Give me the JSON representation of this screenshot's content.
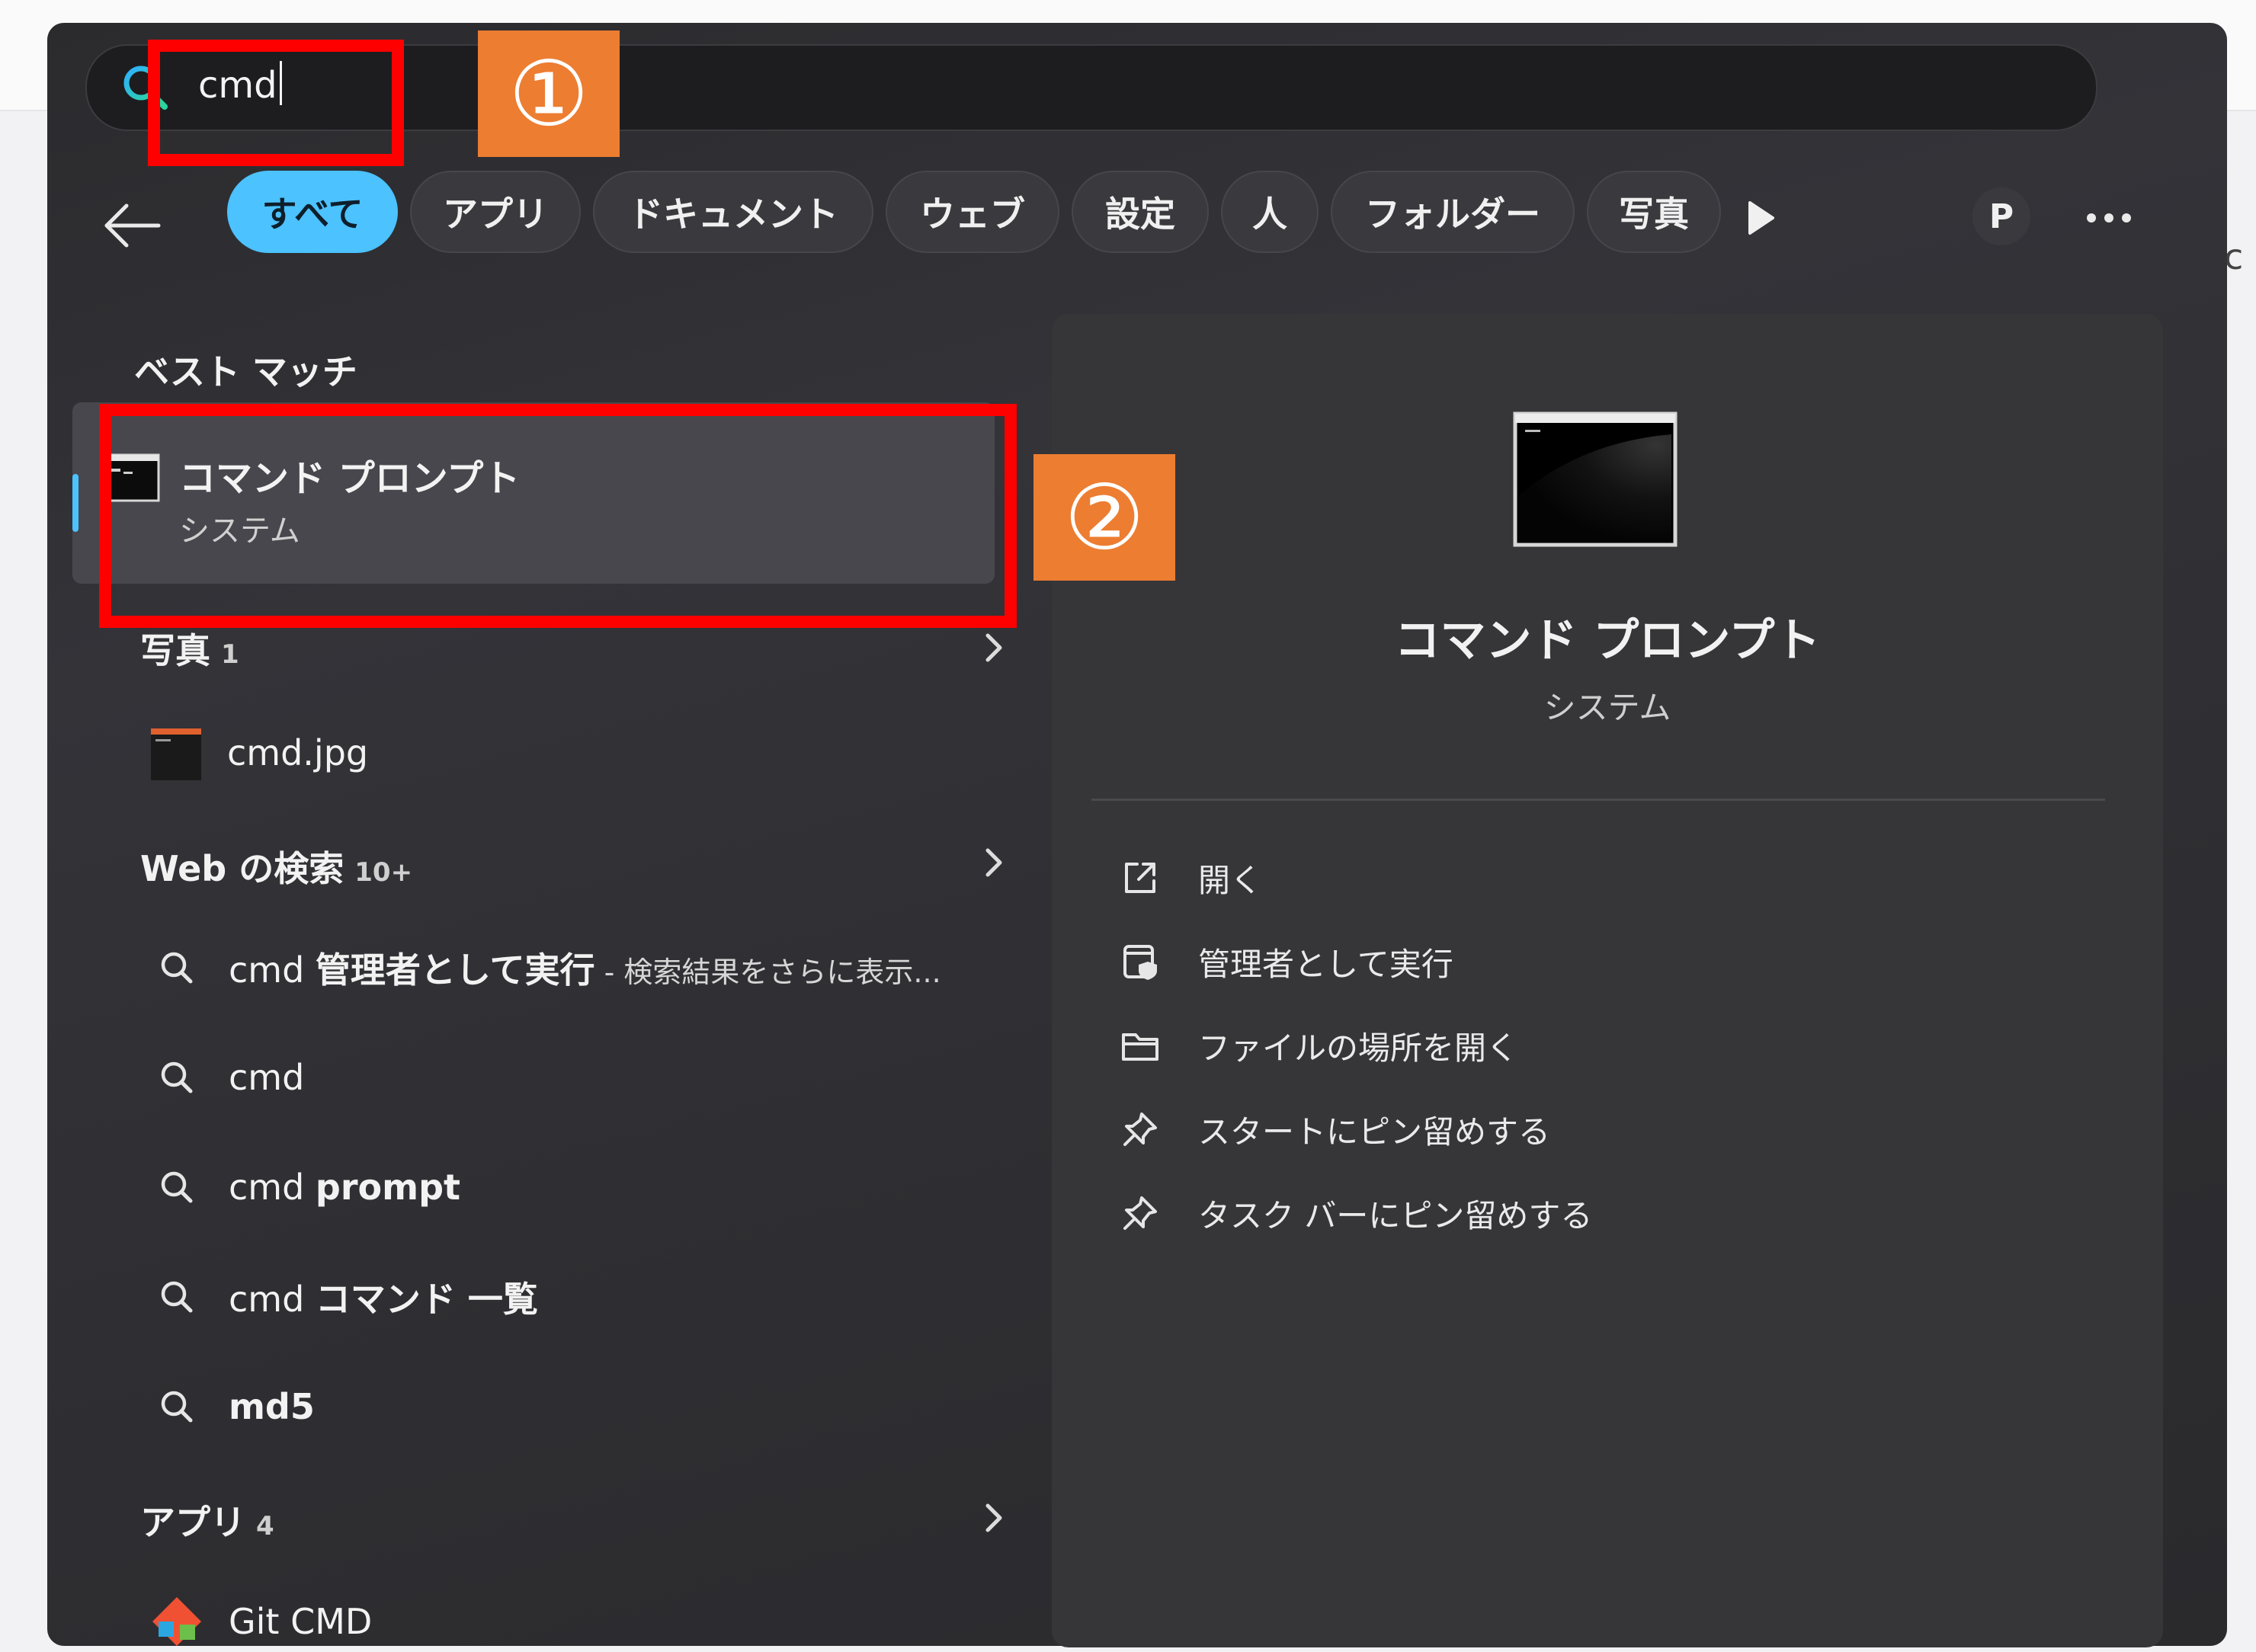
{
  "search": {
    "query": "cmd"
  },
  "filters": [
    "すべて",
    "アプリ",
    "ドキュメント",
    "ウェブ",
    "設定",
    "人",
    "フォルダー",
    "写真"
  ],
  "account": {
    "initial": "P"
  },
  "best_match": {
    "heading": "ベスト マッチ",
    "title": "コマンド プロンプト",
    "subtitle": "システム"
  },
  "photos": {
    "heading": "写真",
    "count": "1",
    "items": [
      "cmd.jpg"
    ]
  },
  "web": {
    "heading": "Web の検索",
    "count": "10+",
    "items": [
      {
        "prefix": "cmd ",
        "bold": "管理者として実行",
        "suffix": " - 検索結果をさらに表示..."
      },
      {
        "prefix": "cmd",
        "bold": "",
        "suffix": ""
      },
      {
        "prefix": "cmd ",
        "bold": "prompt",
        "suffix": ""
      },
      {
        "prefix": "cmd ",
        "bold": "コマンド 一覧",
        "suffix": ""
      },
      {
        "prefix": "",
        "bold": "md5",
        "suffix": ""
      }
    ]
  },
  "apps": {
    "heading": "アプリ",
    "count": "4",
    "items": [
      "Git CMD"
    ]
  },
  "detail": {
    "title": "コマンド プロンプト",
    "subtitle": "システム",
    "actions": [
      "開く",
      "管理者として実行",
      "ファイルの場所を開く",
      "スタートにピン留めする",
      "タスク バーにピン留めする"
    ]
  },
  "annotations": {
    "step1": "①",
    "step2": "②"
  },
  "page_edge": {
    "glyph": "c"
  },
  "colors": {
    "accent": "#4cc2ff",
    "callout": "#ff0000",
    "badge": "#ed7d31"
  }
}
